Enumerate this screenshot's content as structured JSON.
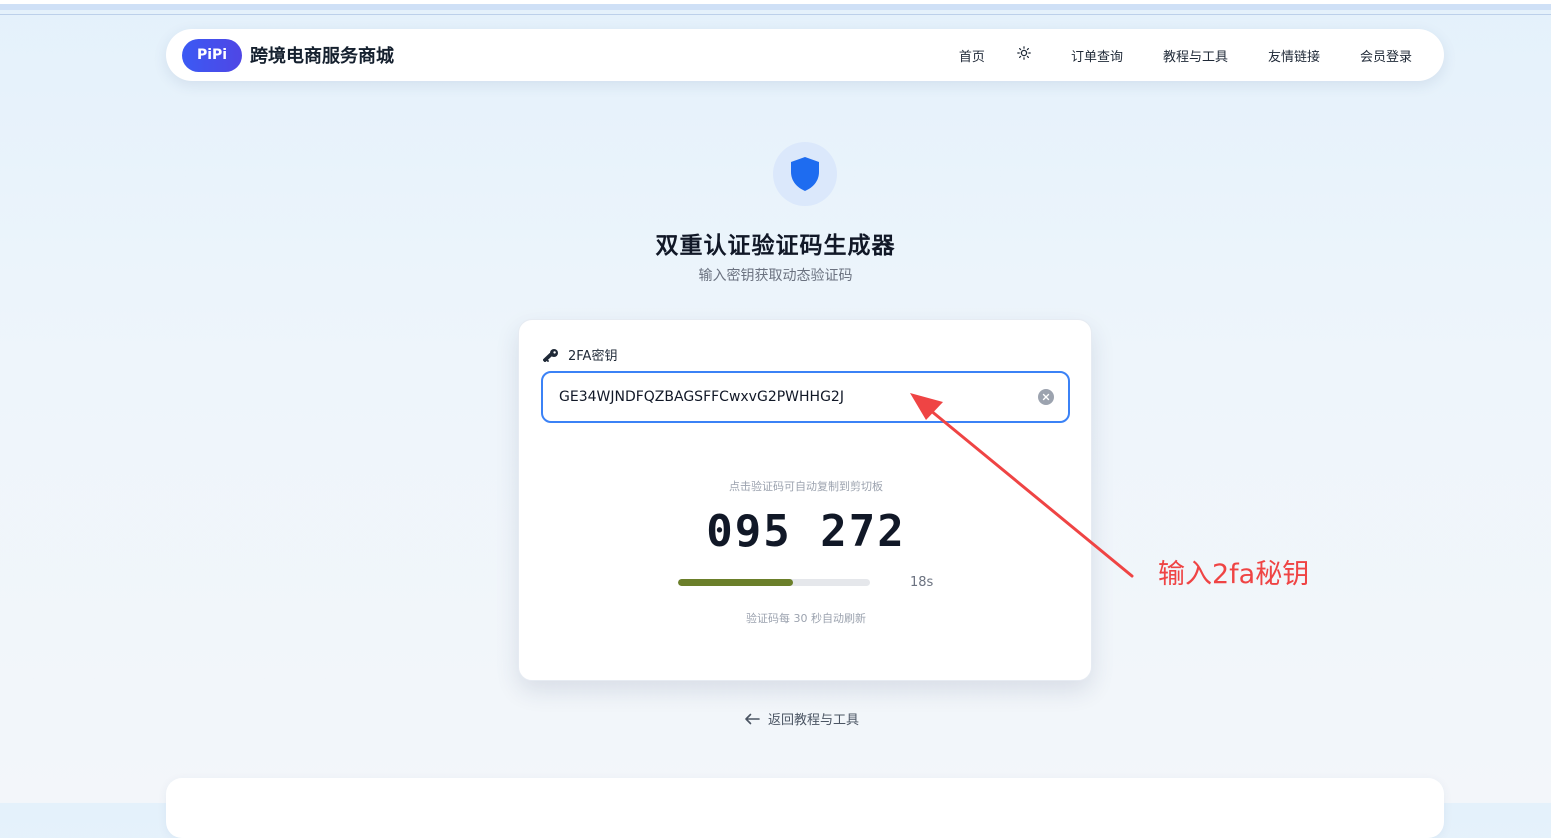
{
  "navbar": {
    "logo": "PiPi",
    "brand": "跨境电商服务商城",
    "links": [
      "首页",
      "订单查询",
      "教程与工具",
      "友情链接",
      "会员登录"
    ],
    "theme_icon": "sun-icon"
  },
  "hero": {
    "icon": "shield-icon",
    "title": "双重认证验证码生成器",
    "subtitle": "输入密钥获取动态验证码"
  },
  "card": {
    "field_label": "2FA密钥",
    "field_icon": "key-icon",
    "secret_value": "GE34WJNDFQZBAGSFFCwxvG2PWHHG2J",
    "hint_top": "点击验证码可自动复制到剪切板",
    "code": "095 272",
    "countdown": "18s",
    "progress_fraction": 0.6,
    "progress_color": "#6b7f2a",
    "hint_bottom": "验证码每 30 秒自动刷新"
  },
  "back_link": "返回教程与工具",
  "annotation": {
    "text": "输入2fa秘钥",
    "color": "#ef4444"
  },
  "colors": {
    "accent": "#3b82f6",
    "logo_gradient_start": "#3b5af4"
  }
}
